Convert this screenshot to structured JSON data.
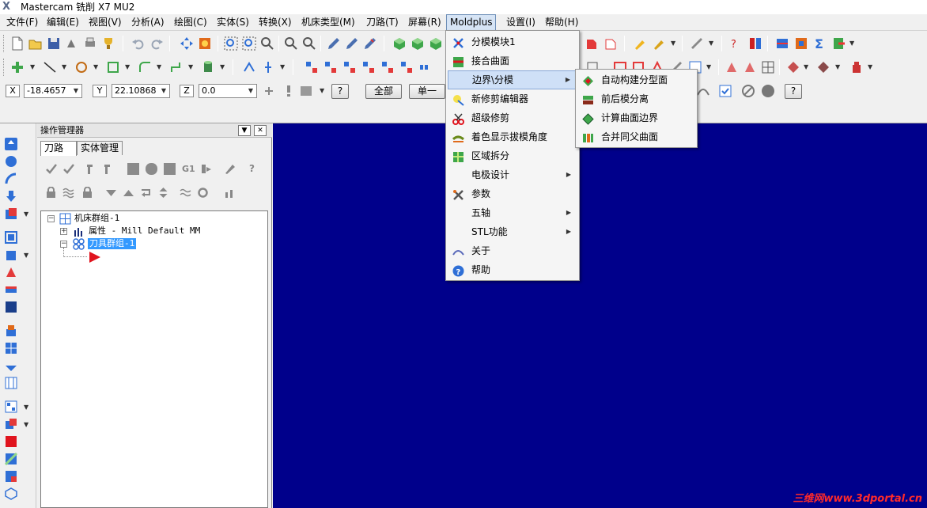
{
  "window": {
    "title": "Mastercam 铣削 X7 MU2",
    "logo": "X"
  },
  "menubar": {
    "items": [
      "文件(F)",
      "编辑(E)",
      "视图(V)",
      "分析(A)",
      "绘图(C)",
      "实体(S)",
      "转换(X)",
      "机床类型(M)",
      "刀路(T)",
      "屏幕(R)",
      "Moldplus",
      "设置(I)",
      "帮助(H)"
    ],
    "active": "Moldplus"
  },
  "coordinates": {
    "x_label": "X",
    "x_value": "-18.4657",
    "y_label": "Y",
    "y_value": "22.10868",
    "z_label": "Z",
    "z_value": "0.0"
  },
  "selection_buttons": {
    "all": "全部",
    "single": "单一"
  },
  "ops_manager": {
    "title": "操作管理器",
    "tabs": [
      "刀路",
      "实体管理"
    ],
    "active_tab": "刀路",
    "g1_label": "G1",
    "tree": {
      "machine_group": "机床群组-1",
      "properties": "属性 - Mill Default MM",
      "toolpath_group": "刀具群组-1"
    }
  },
  "moldplus_menu": {
    "items": [
      {
        "label": "分模模块1",
        "icon": "split-module-icon",
        "submenu": false
      },
      {
        "label": "接合曲面",
        "icon": "join-surface-icon",
        "submenu": false
      },
      {
        "label": "边界\\分模",
        "icon": "",
        "submenu": true,
        "highlighted": true
      },
      {
        "label": "新修剪编辑器",
        "icon": "trim-editor-icon",
        "submenu": false
      },
      {
        "label": "超级修剪",
        "icon": "scissors-icon",
        "submenu": false
      },
      {
        "label": "着色显示拔模角度",
        "icon": "draft-angle-icon",
        "submenu": false
      },
      {
        "label": "区域拆分",
        "icon": "region-split-icon",
        "submenu": false
      },
      {
        "label": "电极设计",
        "icon": "",
        "submenu": true
      },
      {
        "label": "参数",
        "icon": "tools-icon",
        "submenu": false
      },
      {
        "label": "五轴",
        "icon": "",
        "submenu": true
      },
      {
        "label": "STL功能",
        "icon": "",
        "submenu": true
      },
      {
        "label": "关于",
        "icon": "about-icon",
        "submenu": false
      },
      {
        "label": "帮助",
        "icon": "help-icon",
        "submenu": false
      }
    ]
  },
  "boundary_submenu": {
    "items": [
      {
        "label": "自动构建分型面",
        "icon": "auto-parting-icon"
      },
      {
        "label": "前后模分离",
        "icon": "core-cavity-split-icon"
      },
      {
        "label": "计算曲面边界",
        "icon": "surface-boundary-icon"
      },
      {
        "label": "合并同父曲面",
        "icon": "merge-surfaces-icon"
      }
    ]
  },
  "watermark": "三维网www.3dportal.cn",
  "colors": {
    "viewport": "#00008b",
    "menu_highlight": "#cfe0f7",
    "watermark": "#ff2a2a"
  }
}
